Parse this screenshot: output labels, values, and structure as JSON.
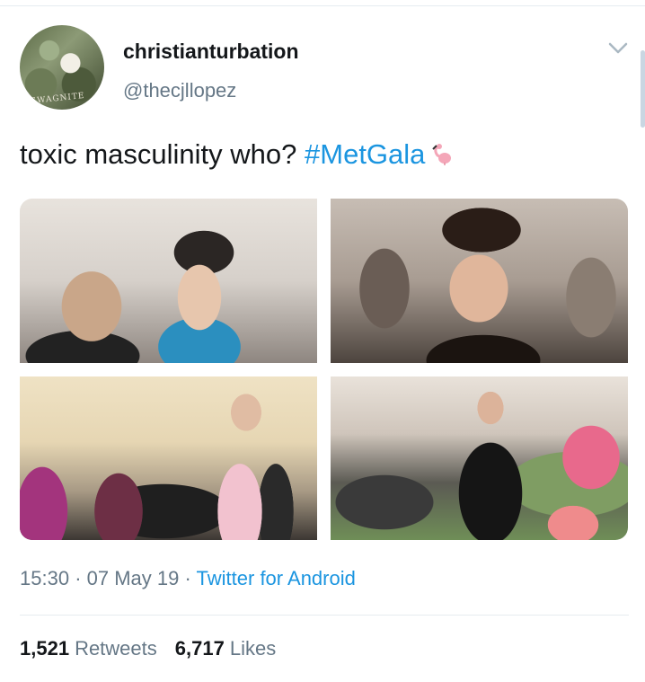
{
  "tweet": {
    "display_name": "christianturbation",
    "handle": "@thecjllopez",
    "text_plain": "toxic masculinity who? ",
    "hashtag": "#MetGala",
    "emoji_icon": "flamingo-emoji",
    "time": "15:30",
    "separator": "·",
    "date": "07 May 19",
    "source": "Twitter for Android",
    "retweets_count": "1,521",
    "retweets_label": "Retweets",
    "likes_count": "6,717",
    "likes_label": "Likes"
  },
  "colors": {
    "link": "#1b95e0",
    "secondary_text": "#657786",
    "primary_text": "#14171a",
    "divider": "#e6ecf0"
  },
  "media": {
    "photos": [
      "photo-1",
      "photo-2",
      "photo-3",
      "photo-4"
    ]
  }
}
